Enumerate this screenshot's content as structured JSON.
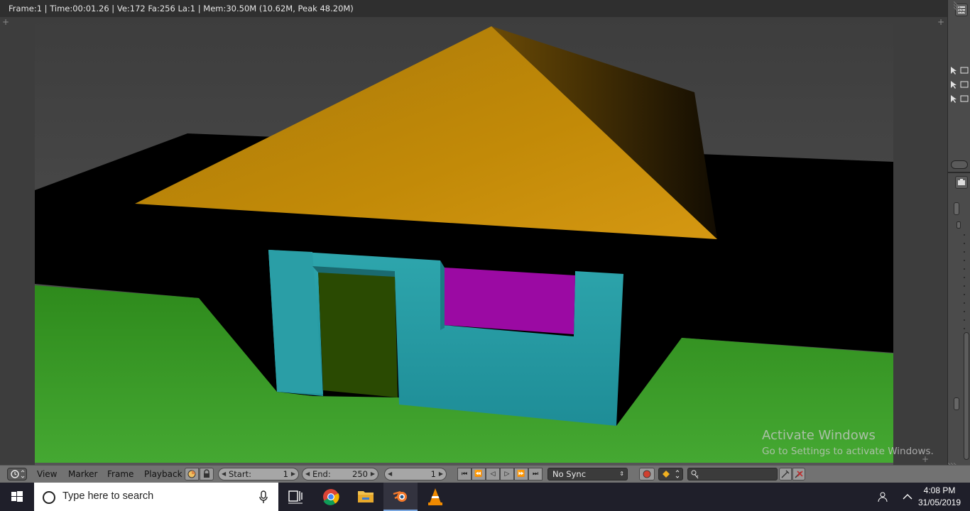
{
  "render_header": {
    "stats": "Frame:1 | Time:00:01.26 | Ve:172 Fa:256 La:1 | Mem:30.50M (10.62M, Peak 48.20M)"
  },
  "timeline": {
    "menus": [
      "View",
      "Marker",
      "Frame",
      "Playback"
    ],
    "start_label": "Start:",
    "start_value": "1",
    "end_label": "End:",
    "end_value": "250",
    "current_frame": "1",
    "sync_mode": "No Sync"
  },
  "watermark": {
    "title": "Activate Windows",
    "subtitle": "Go to Settings to activate Windows."
  },
  "taskbar": {
    "search_placeholder": "Type here to search",
    "time": "4:08 PM",
    "date": "31/05/2019",
    "apps": [
      "task-view",
      "chrome",
      "file-explorer",
      "blender",
      "vlc"
    ]
  },
  "colors": {
    "roof": "#b8860b",
    "walls": "#2aa0a8",
    "window": "#9a0aa0",
    "door": "#2a4a00",
    "ground": "#3a9a24",
    "sky": "#4a4a4a",
    "accent": "#7aa7e0"
  }
}
